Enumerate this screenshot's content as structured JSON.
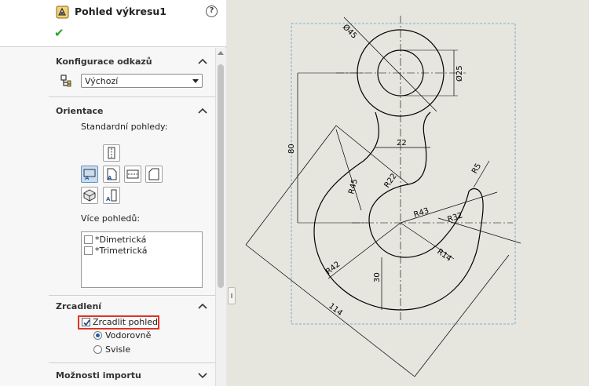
{
  "panel": {
    "title": "Pohled výkresu1",
    "help": "?",
    "ok_icon": "checkmark-icon",
    "sections": {
      "reference_config": {
        "title": "Konfigurace odkazů",
        "selected": "Výchozí"
      },
      "orientation": {
        "title": "Orientace",
        "standard_views_label": "Standardní pohledy:",
        "more_views_label": "Více pohledů:",
        "more_views": [
          {
            "label": "*Dimetrická",
            "checked": false
          },
          {
            "label": "*Trimetrická",
            "checked": false
          }
        ]
      },
      "mirror": {
        "title": "Zrcadlení",
        "mirror_view_label": "Zrcadlit pohled",
        "mirror_view_checked": true,
        "horizontal_label": "Vodorovně",
        "vertical_label": "Svisle",
        "selected_direction": "horizontal"
      },
      "import_options": {
        "title": "Možnosti importu"
      }
    }
  },
  "drawing": {
    "dimensions": {
      "d45": "Ø45",
      "d25": "Ø25",
      "w22": "22",
      "h80": "80",
      "r45": "R45",
      "r22": "R22",
      "r5": "R5",
      "r43": "R43",
      "r32": "R32",
      "r42": "R42",
      "r14": "R14",
      "v30": "30",
      "l114": "114"
    },
    "colors": {
      "selection_box": "#5b9bd5",
      "geometry": "#000000"
    }
  }
}
